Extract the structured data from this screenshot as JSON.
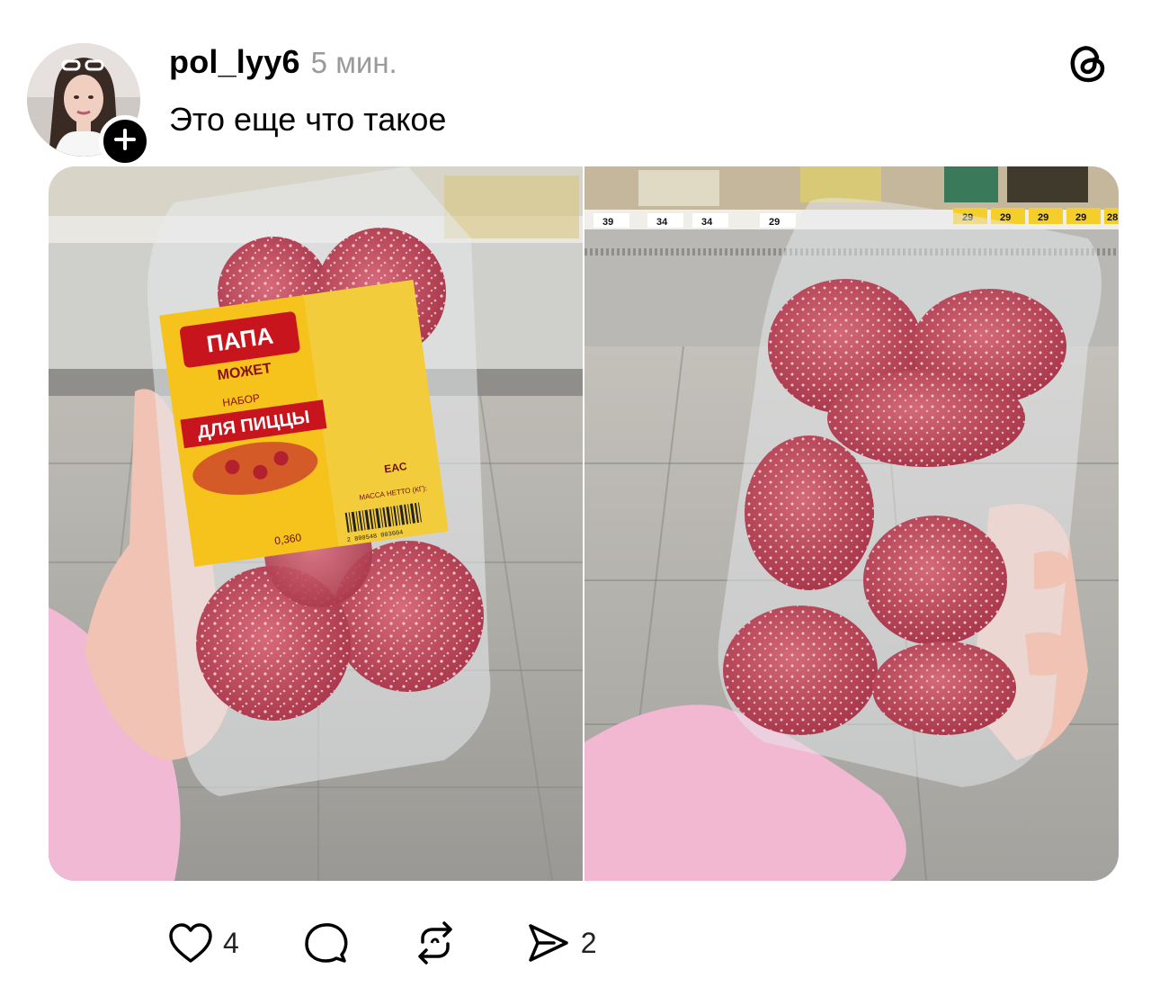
{
  "post": {
    "username": "pol_lyy6",
    "time": "5 мин.",
    "text": "Это еще что такое"
  },
  "icons": {
    "app_logo": "threads-icon",
    "follow": "plus-icon",
    "like": "heart-icon",
    "reply": "comment-icon",
    "repost": "repost-icon",
    "share": "send-icon"
  },
  "package_label": {
    "brand_line1": "ПАПА",
    "brand_line2": "МОЖЕТ",
    "set": "НАБОР",
    "product": "ДЛЯ ПИЦЦЫ",
    "weight": "0,360",
    "mass_caption": "МАССА НЕТТО (КГ):",
    "eac": "EAC",
    "barcode": "2 800548 003604"
  },
  "shelf_prices": {
    "left_labels": [
      "39",
      "34",
      "34",
      "29"
    ],
    "right_labels": [
      "29",
      "29",
      "29",
      "29",
      "28"
    ]
  },
  "actions": {
    "likes": "4",
    "shares": "2"
  },
  "colors": {
    "time_gray": "#9a9a9a",
    "label_yellow": "#f6c21c",
    "label_red": "#c8141c",
    "salami": "#c24a5a"
  }
}
